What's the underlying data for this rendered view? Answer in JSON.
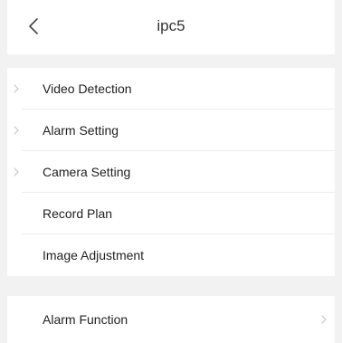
{
  "header": {
    "title": "ipc5",
    "back_icon": "chevron-left-icon"
  },
  "settings": {
    "items": [
      {
        "label": "Video Detection",
        "icon": "chevron-right-icon"
      },
      {
        "label": "Alarm Setting",
        "icon": "chevron-right-icon"
      },
      {
        "label": "Camera Setting",
        "icon": "chevron-right-icon"
      },
      {
        "label": "Record Plan"
      },
      {
        "label": "Image Adjustment"
      }
    ]
  },
  "functions": {
    "items": [
      {
        "label": "Alarm Function",
        "icon": "chevron-right-icon"
      }
    ]
  },
  "colors": {
    "background": "#f2f2f2",
    "surface": "#ffffff",
    "text": "#222222",
    "chevron": "#c7c7cc",
    "divider": "#ececec"
  }
}
